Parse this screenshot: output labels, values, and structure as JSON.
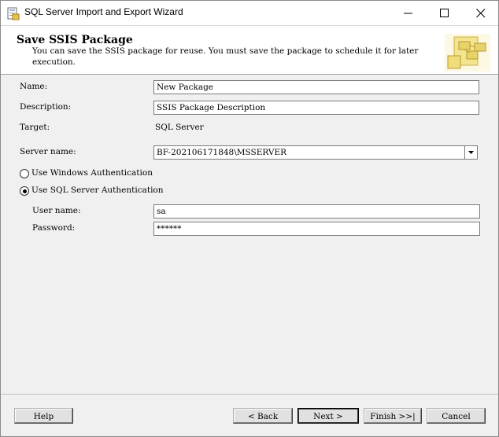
{
  "window": {
    "title": "SQL Server Import and Export Wizard"
  },
  "header": {
    "title": "Save SSIS Package",
    "description": "You can save the SSIS package for reuse. You must save the package to schedule it for later execution."
  },
  "form": {
    "name_label": "Name:",
    "name_value": "New Package",
    "description_label": "Description:",
    "description_value": "SSIS Package Description",
    "target_label": "Target:",
    "target_value": "SQL Server",
    "server_label": "Server name:",
    "server_value": "BF-202106171848\\MSSERVER",
    "auth_windows_label": "Use Windows Authentication",
    "auth_sql_label": "Use SQL Server Authentication",
    "auth_selected": "sql",
    "username_label": "User name:",
    "username_value": "sa",
    "password_label": "Password:",
    "password_value": "******"
  },
  "footer": {
    "help_label": "Help",
    "back_label": "< Back",
    "next_label": "Next >",
    "finish_label": "Finish >>|",
    "cancel_label": "Cancel"
  },
  "icons": {
    "app": "wizard-app-icon",
    "header": "ssis-package-icon",
    "minimize": "minimize-icon",
    "maximize": "maximize-icon",
    "close": "close-icon",
    "dropdown": "chevron-down-icon"
  },
  "colors": {
    "header_bg": "#ffffff",
    "dialog_bg": "#f0f0f0",
    "title_bar_bg": "#ffffff"
  }
}
